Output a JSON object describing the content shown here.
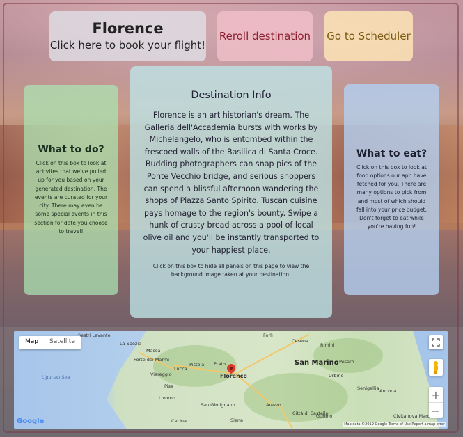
{
  "header": {
    "city": "Florence",
    "book_flight": "Click here to book your flight!",
    "reroll": "Reroll destination",
    "scheduler": "Go to Scheduler"
  },
  "todo_panel": {
    "title": "What to do?",
    "text": "Click on this box to look at activites that we've pulled up for you based on your generated destination. The events are curated for your city. There may even be some special events in this section for date you choose to travel!"
  },
  "info_panel": {
    "title": "Destination Info",
    "text": "Florence is an art historian's dream. The Galleria dell'Accademia bursts with works by Michelangelo, who is entombed within the frescoed walls of the Basilica di Santa Croce. Budding photographers can snap pics of the Ponte Vecchio bridge, and serious shoppers can spend a blissful afternoon wandering the shops of Piazza Santo Spirito. Tuscan cuisine pays homage to the region's bounty. Swipe a hunk of crusty bread across a pool of local olive oil and you'll be instantly transported to your happiest place.",
    "note": "Click on this box to hide all panels on this page to view the background image taken at your destination!"
  },
  "eat_panel": {
    "title": "What to eat?",
    "text": "Click on this box to look at food options our app have fetched for you. There are many options to pick from and most of which should fall into your price budget. Don't forget to eat while you're having fun!"
  },
  "map": {
    "type_map": "Map",
    "type_satellite": "Satellite",
    "marker_label": "Florence",
    "labels": {
      "sestri": "Sestri Levante",
      "laspezia": "La Spezia",
      "massa": "Massa",
      "fortedeimarmi": "Forte dei Marmi",
      "viareggio": "Viareggio",
      "lucca": "Lucca",
      "pisa": "Pisa",
      "pistoia": "Pistoia",
      "prato": "Prato",
      "livorno": "Livorno",
      "sangimignano": "San Gimignano",
      "arezzo": "Arezzo",
      "siena": "Siena",
      "cecina": "Cecina",
      "cesena": "Cesena",
      "rimini": "Rimini",
      "sanmarino": "San Marino",
      "pesaro": "Pesaro",
      "senigallia": "Senigallia",
      "ancona": "Ancona",
      "gubbio": "Gubbio",
      "cittadicastello": "Città di Castello",
      "civitanova": "Civitanova Marche",
      "ligurian": "Ligurian Sea",
      "forli": "Forlì",
      "urbino": "Urbino"
    },
    "attribution": "Map data ©2019 Google   Terms of Use   Report a map error",
    "google": "Google"
  }
}
